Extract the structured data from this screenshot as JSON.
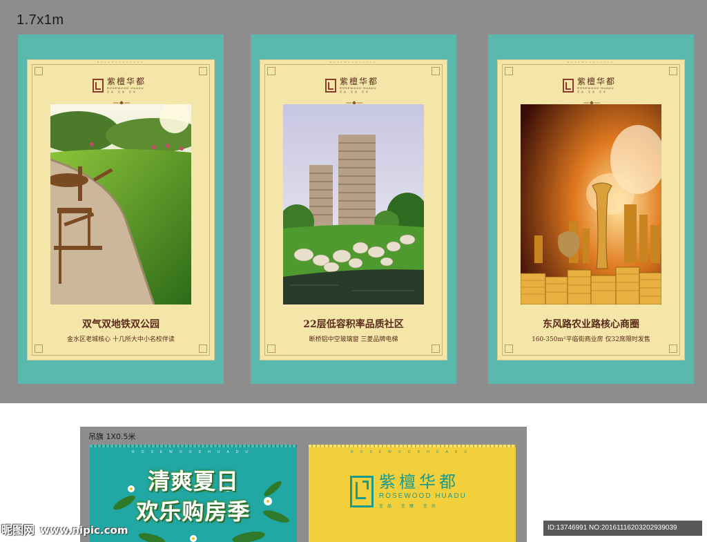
{
  "canvas": {
    "size_label": "1.7x1m"
  },
  "colors": {
    "teal_bg": "#5bb8ad",
    "cream_panel": "#f4e6a9",
    "brown_text": "#5a2a1a",
    "flag_green": "#22a8a4",
    "flag_yellow": "#f2d03c",
    "logo_teal": "#1c9a8c"
  },
  "brand": {
    "name_cn": "紫檀华都",
    "name_en": "ROSEWOOD HUADU",
    "tagline": "至品 至臻 至尚",
    "letters": "ROSEWOODHUADU",
    "logo_icon": "seal-logo-icon"
  },
  "posters": [
    {
      "photo": "garden-patio-photo",
      "headline": "双气双地铁双公园",
      "subline": "金水区老城核心 十几所大中小名校伴读"
    },
    {
      "photo": "high-rise-towers-photo",
      "headline": "22层低容积率品质社区",
      "subline": "断桥铝中空玻璃窗 三菱品牌电梯"
    },
    {
      "photo": "golden-city-coins-photo",
      "headline": "东风路农业路核心商圈",
      "subline": "160-350m²平临街商业房 仅32席限时发售"
    }
  ],
  "flags": {
    "label": "吊旗 1X0.5米",
    "green": {
      "line1": "清爽夏日",
      "line2": "欢乐购房季"
    }
  },
  "watermark": {
    "site": "昵图网",
    "url": "www.nipic.com",
    "id_text": "ID:13746991 NO:20161116203202939039"
  }
}
